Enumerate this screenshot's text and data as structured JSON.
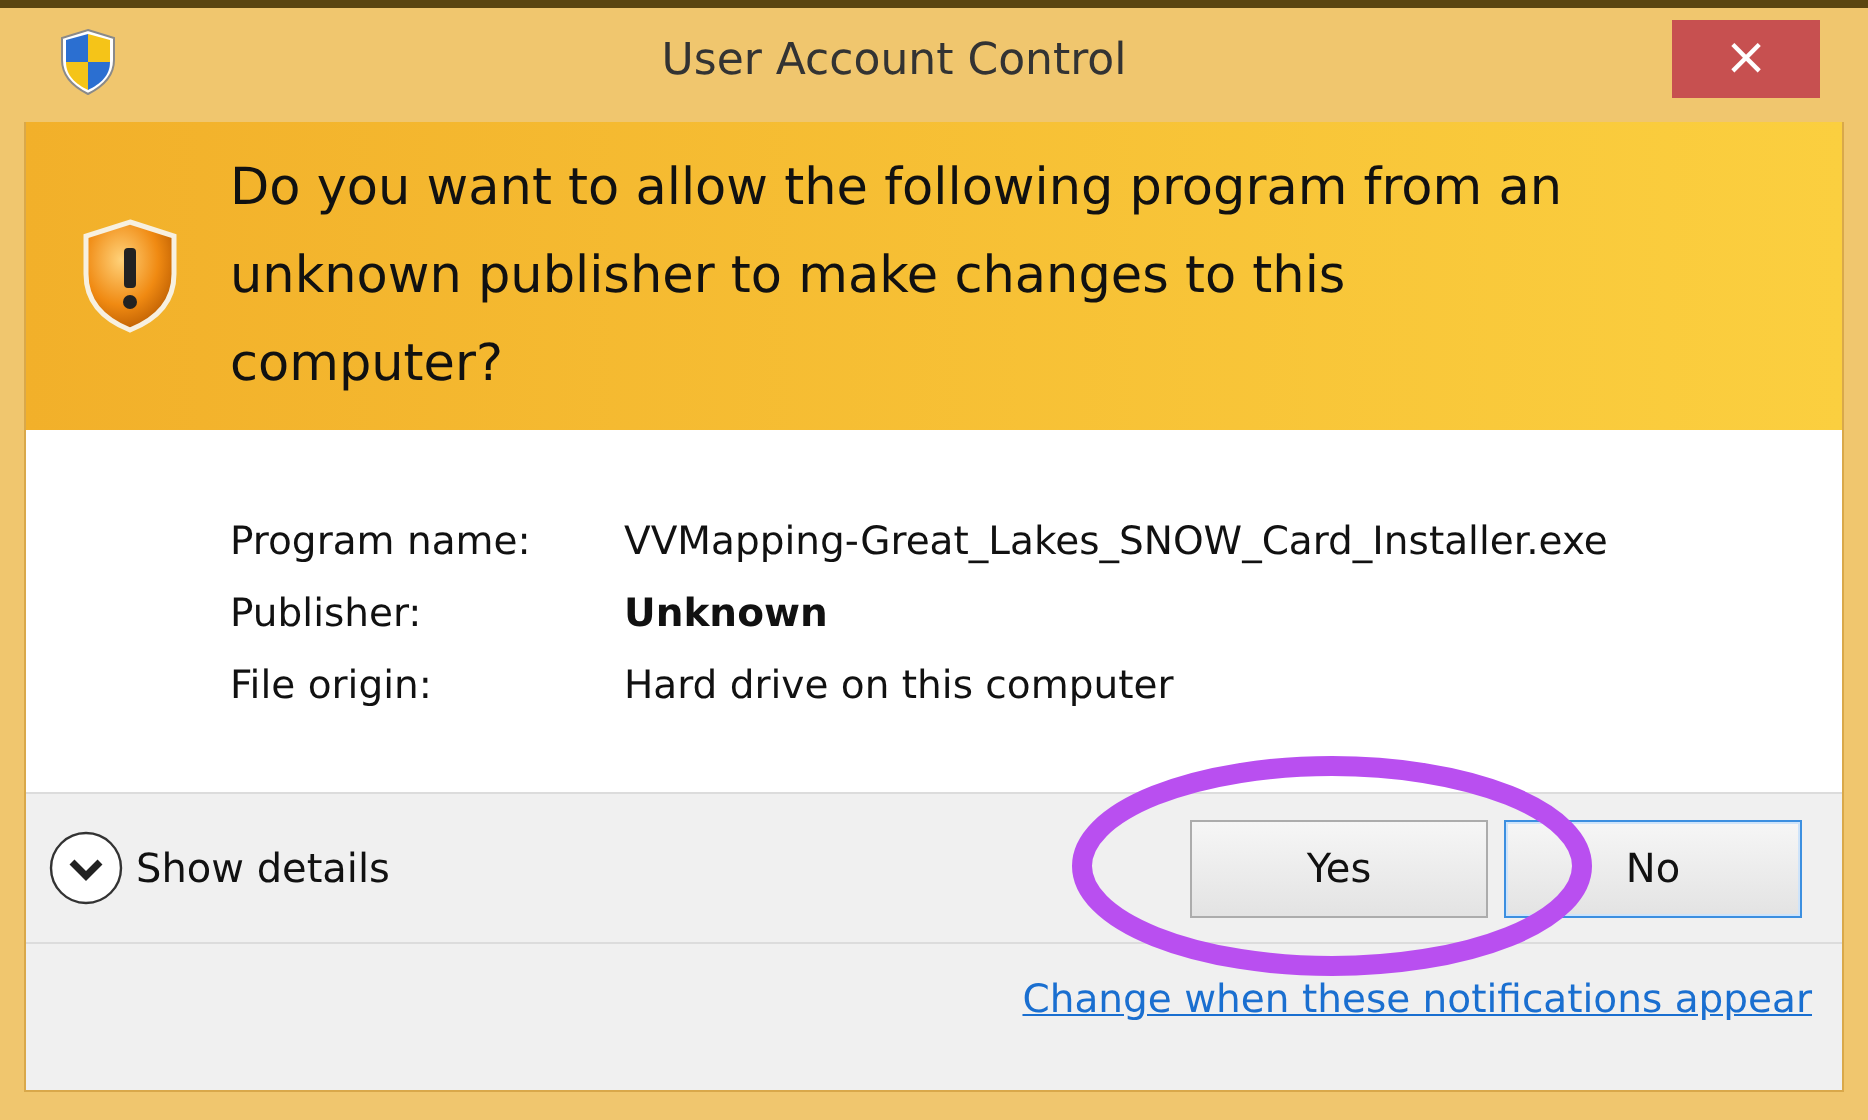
{
  "window": {
    "title": "User Account Control",
    "close": "×"
  },
  "header": {
    "question": "Do you want to allow the following program from an unknown publisher to make changes to this computer?"
  },
  "details": [
    {
      "label": "Program name:",
      "value": "VVMapping-Great_Lakes_SNOW_Card_Installer.exe",
      "bold": false
    },
    {
      "label": "Publisher:",
      "value": "Unknown",
      "bold": true
    },
    {
      "label": "File origin:",
      "value": "Hard drive on this computer",
      "bold": false
    }
  ],
  "show_details": {
    "label": "Show details",
    "expanded": false
  },
  "buttons": [
    {
      "label": "Yes",
      "focused": false
    },
    {
      "label": "No",
      "focused": true
    }
  ],
  "link": "Change when these notifications appear",
  "highlight": {
    "kind": "ellipse"
  }
}
